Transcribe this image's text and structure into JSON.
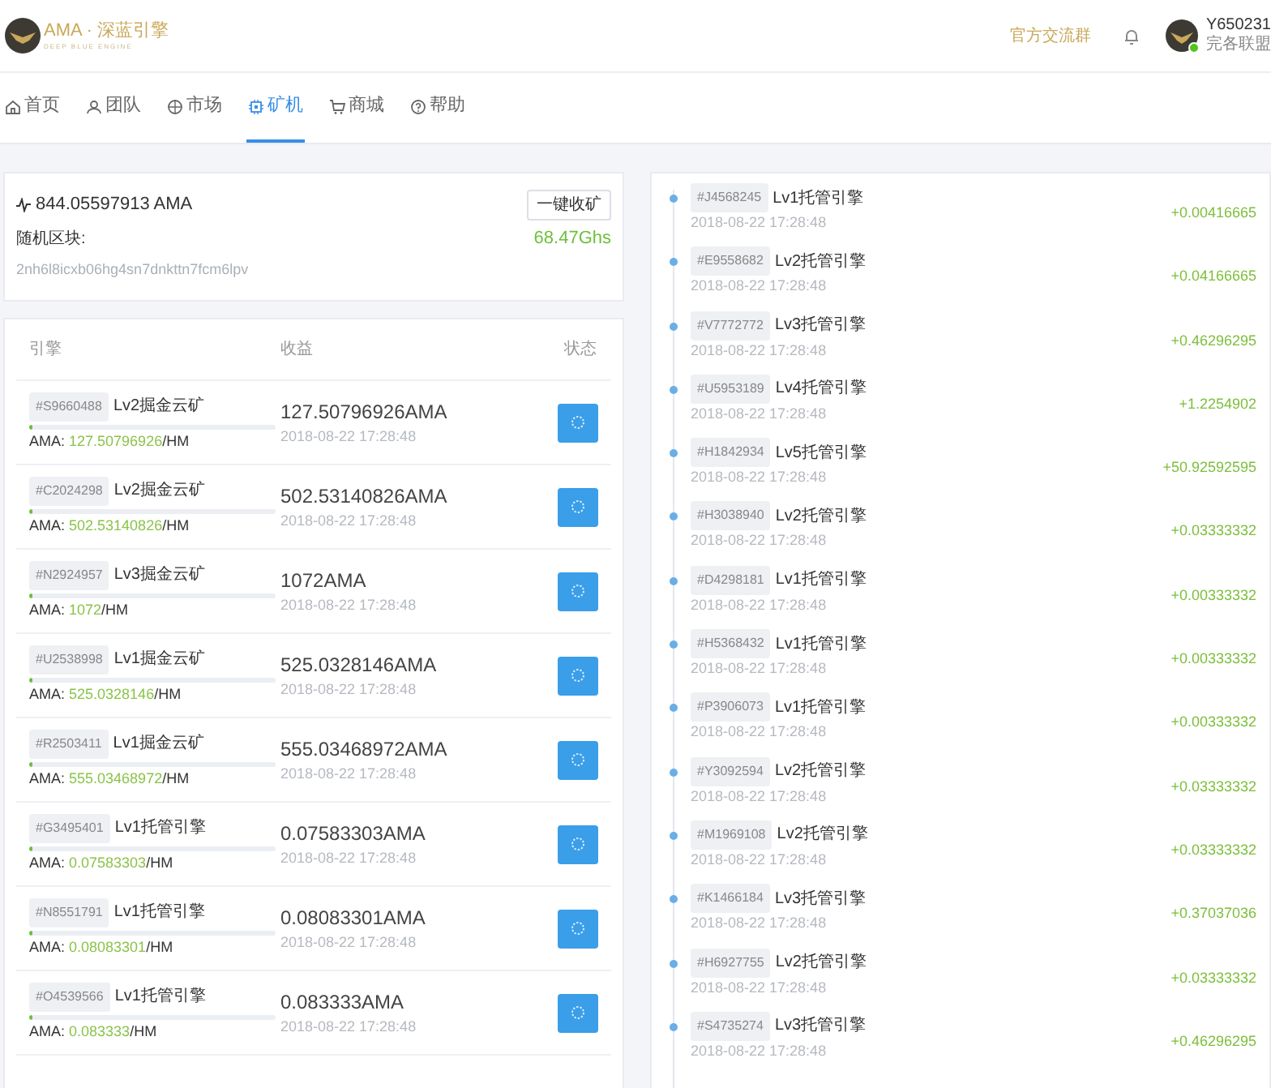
{
  "header": {
    "logo_title": "AMA · 深蓝引擎",
    "logo_subtitle": "DEEP BLUE ENGINE",
    "group_link": "官方交流群",
    "user": {
      "name": "Y650231",
      "team": "完各联盟",
      "online": true
    }
  },
  "nav": [
    {
      "label": "首页",
      "kind": "home",
      "selected": false
    },
    {
      "label": "团队",
      "kind": "team",
      "selected": false
    },
    {
      "label": "市场",
      "kind": "globe",
      "selected": false
    },
    {
      "label": "矿机",
      "kind": "chip",
      "selected": true
    },
    {
      "label": "商城",
      "kind": "cart",
      "selected": false
    },
    {
      "label": "帮助",
      "kind": "help",
      "selected": false
    }
  ],
  "summary": {
    "balance": "844.05597913 AMA",
    "collect_button": "一键收矿",
    "block_label": "随机区块:",
    "hashrate": "68.47Ghs",
    "block_hash": "2nh6l8icxb06hg4sn7dnkttn7fcm6lpv"
  },
  "table": {
    "columns": [
      "引擎",
      "收益",
      "状态"
    ],
    "rows": [
      {
        "id": "#S9660488",
        "name": "Lv2掘金云矿",
        "level": 0.01,
        "rate": "AMA: **127.50796926**/HM",
        "income": "127.50796926AMA",
        "time": "2018-08-22 17:28:48"
      },
      {
        "id": "#C2024298",
        "name": "Lv2掘金云矿",
        "level": 0.01,
        "rate": "AMA: **502.53140826**/HM",
        "income": "502.53140826AMA",
        "time": "2018-08-22 17:28:48"
      },
      {
        "id": "#N2924957",
        "name": "Lv3掘金云矿",
        "level": 0.01,
        "rate": "AMA: **1072**/HM",
        "income": "1072AMA",
        "time": "2018-08-22 17:28:48"
      },
      {
        "id": "#U2538998",
        "name": "Lv1掘金云矿",
        "level": 0.01,
        "rate": "AMA: **525.0328146**/HM",
        "income": "525.0328146AMA",
        "time": "2018-08-22 17:28:48"
      },
      {
        "id": "#R2503411",
        "name": "Lv1掘金云矿",
        "level": 0.01,
        "rate": "AMA: **555.03468972**/HM",
        "income": "555.03468972AMA",
        "time": "2018-08-22 17:28:48"
      },
      {
        "id": "#G3495401",
        "name": "Lv1托管引擎",
        "level": 0.01,
        "rate": "AMA: **0.07583303**/HM",
        "income": "0.07583303AMA",
        "time": "2018-08-22 17:28:48"
      },
      {
        "id": "#N8551791",
        "name": "Lv1托管引擎",
        "level": 0.01,
        "rate": "AMA: **0.08083301**/HM",
        "income": "0.08083301AMA",
        "time": "2018-08-22 17:28:48"
      },
      {
        "id": "#O4539566",
        "name": "Lv1托管引擎",
        "level": 0.01,
        "rate": "AMA: **0.083333**/HM",
        "income": "0.083333AMA",
        "time": "2018-08-22 17:28:48"
      }
    ]
  },
  "log": [
    {
      "id": "#J4568245",
      "name": "Lv1托管引擎",
      "time": "2018-08-22 17:28:48",
      "amount": "+0.00416665"
    },
    {
      "id": "#E9558682",
      "name": "Lv2托管引擎",
      "time": "2018-08-22 17:28:48",
      "amount": "+0.04166665"
    },
    {
      "id": "#V7772772",
      "name": "Lv3托管引擎",
      "time": "2018-08-22 17:28:48",
      "amount": "+0.46296295"
    },
    {
      "id": "#U5953189",
      "name": "Lv4托管引擎",
      "time": "2018-08-22 17:28:48",
      "amount": "+1.2254902"
    },
    {
      "id": "#H1842934",
      "name": "Lv5托管引擎",
      "time": "2018-08-22 17:28:48",
      "amount": "+50.92592595"
    },
    {
      "id": "#H3038940",
      "name": "Lv2托管引擎",
      "time": "2018-08-22 17:28:48",
      "amount": "+0.03333332"
    },
    {
      "id": "#D4298181",
      "name": "Lv1托管引擎",
      "time": "2018-08-22 17:28:48",
      "amount": "+0.00333332"
    },
    {
      "id": "#H5368432",
      "name": "Lv1托管引擎",
      "time": "2018-08-22 17:28:48",
      "amount": "+0.00333332"
    },
    {
      "id": "#P3906073",
      "name": "Lv1托管引擎",
      "time": "2018-08-22 17:28:48",
      "amount": "+0.00333332"
    },
    {
      "id": "#Y3092594",
      "name": "Lv2托管引擎",
      "time": "2018-08-22 17:28:48",
      "amount": "+0.03333332"
    },
    {
      "id": "#M1969108",
      "name": "Lv2托管引擎",
      "time": "2018-08-22 17:28:48",
      "amount": "+0.03333332"
    },
    {
      "id": "#K1466184",
      "name": "Lv3托管引擎",
      "time": "2018-08-22 17:28:48",
      "amount": "+0.37037036"
    },
    {
      "id": "#H6927755",
      "name": "Lv2托管引擎",
      "time": "2018-08-22 17:28:48",
      "amount": "+0.03333332"
    },
    {
      "id": "#S4735274",
      "name": "Lv3托管引擎",
      "time": "2018-08-22 17:28:48",
      "amount": "+0.46296295"
    }
  ]
}
